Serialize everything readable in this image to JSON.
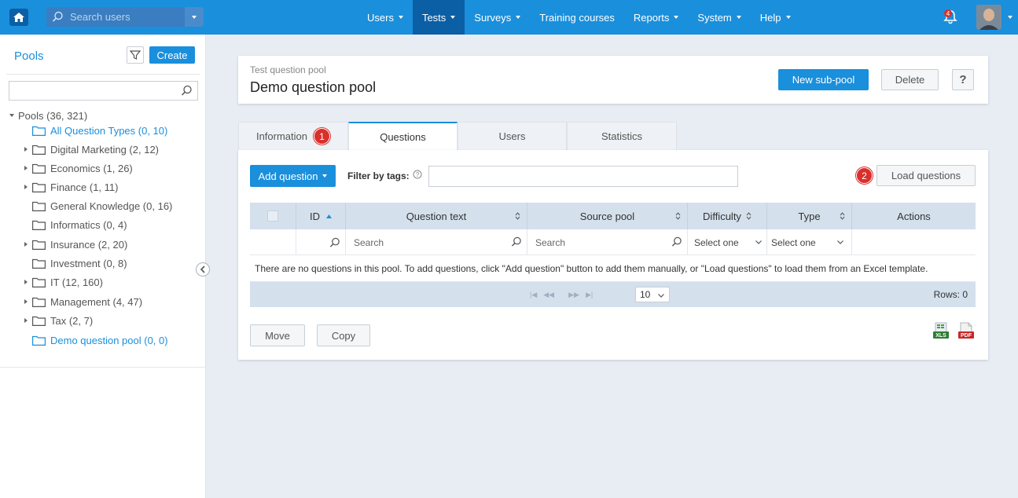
{
  "topbar": {
    "search_placeholder": "Search users",
    "nav": [
      {
        "label": "Users",
        "caret": true,
        "active": false
      },
      {
        "label": "Tests",
        "caret": true,
        "active": true
      },
      {
        "label": "Surveys",
        "caret": true,
        "active": false
      },
      {
        "label": "Training courses",
        "caret": false,
        "active": false
      },
      {
        "label": "Reports",
        "caret": true,
        "active": false
      },
      {
        "label": "System",
        "caret": true,
        "active": false
      },
      {
        "label": "Help",
        "caret": true,
        "active": false
      }
    ],
    "notifications_count": "4"
  },
  "sidebar": {
    "title": "Pools",
    "create_label": "Create",
    "root": "Pools (36, 321)",
    "items": [
      {
        "label": "All Question Types (0, 10)",
        "expandable": false,
        "blue": true
      },
      {
        "label": "Digital Marketing (2, 12)",
        "expandable": true,
        "blue": false
      },
      {
        "label": "Economics (1, 26)",
        "expandable": true,
        "blue": false
      },
      {
        "label": "Finance (1, 11)",
        "expandable": true,
        "blue": false
      },
      {
        "label": "General Knowledge (0, 16)",
        "expandable": false,
        "blue": false
      },
      {
        "label": "Informatics (0, 4)",
        "expandable": false,
        "blue": false
      },
      {
        "label": "Insurance (2, 20)",
        "expandable": true,
        "blue": false
      },
      {
        "label": "Investment (0, 8)",
        "expandable": false,
        "blue": false
      },
      {
        "label": "IT (12, 160)",
        "expandable": true,
        "blue": false
      },
      {
        "label": "Management (4, 47)",
        "expandable": true,
        "blue": false
      },
      {
        "label": "Tax (2, 7)",
        "expandable": true,
        "blue": false
      },
      {
        "label": "Demo question pool (0, 0)",
        "expandable": false,
        "blue": true
      }
    ]
  },
  "header": {
    "subtitle": "Test question pool",
    "title": "Demo question pool",
    "new_subpool_label": "New sub-pool",
    "delete_label": "Delete",
    "help_label": "?"
  },
  "tabs": {
    "information": "Information",
    "questions": "Questions",
    "users": "Users",
    "statistics": "Statistics",
    "badge1": "1",
    "badge2": "2"
  },
  "toolbar": {
    "add_question_label": "Add question",
    "filter_label": "Filter by tags:",
    "load_questions_label": "Load questions"
  },
  "table": {
    "columns": {
      "id": "ID",
      "question_text": "Question text",
      "source_pool": "Source pool",
      "difficulty": "Difficulty",
      "type": "Type",
      "actions": "Actions"
    },
    "search_placeholder": "Search",
    "select_placeholder": "Select one",
    "empty_message": "There are no questions in this pool. To add questions, click \"Add question\" button to add them manually, or \"Load questions\" to load them from an Excel template.",
    "page_size": "10",
    "rows_label": "Rows: 0"
  },
  "footer": {
    "move_label": "Move",
    "copy_label": "Copy",
    "xls_label": "XLS",
    "pdf_label": "PDF"
  },
  "colors": {
    "primary": "#1a8fdc",
    "topbar": "#1a8fdc",
    "badge": "#d9302c"
  }
}
